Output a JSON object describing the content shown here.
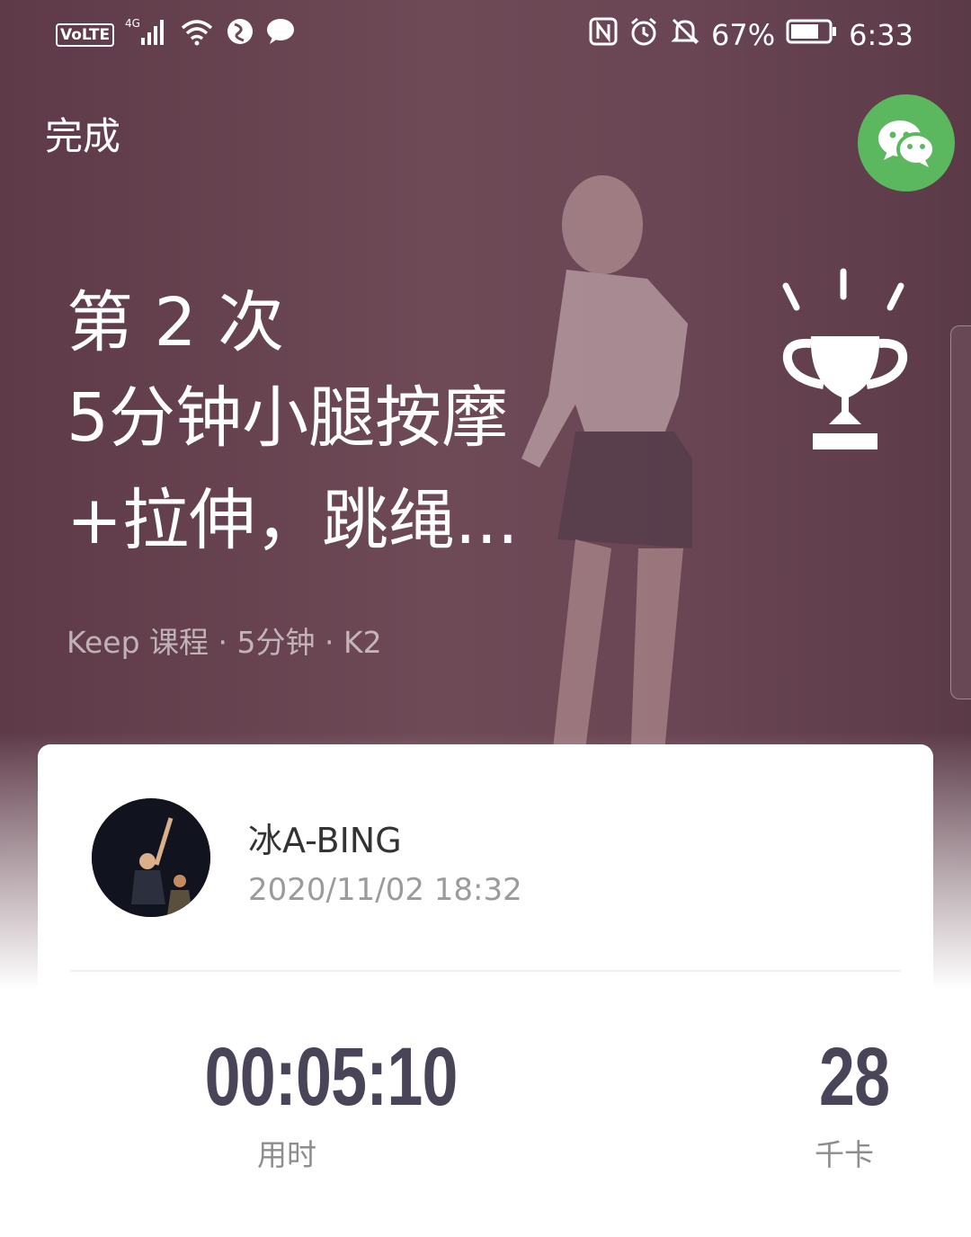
{
  "status_bar": {
    "volte": "VoLTE",
    "network": "4G",
    "battery": "67%",
    "time": "6:33"
  },
  "header": {
    "done_label": "完成"
  },
  "workout": {
    "count_label": "第 2 次",
    "title_line1": "5分钟小腿按摩",
    "title_line2": "+拉伸，跳绳...",
    "meta": "Keep 课程 · 5分钟 · K2"
  },
  "user": {
    "name": "冰A-BING",
    "datetime": "2020/11/02 18:32"
  },
  "stats": {
    "duration_value": "00:05:10",
    "duration_label": "用时",
    "calories_value": "28",
    "calories_label": "千卡"
  },
  "colors": {
    "wechat_green": "#5cb85f",
    "hero_tint": "#6a4553",
    "stat_text": "#4a4458"
  },
  "icons": [
    "volte-icon",
    "signal-icon",
    "wifi-icon",
    "vpn-icon",
    "message-icon",
    "nfc-icon",
    "alarm-icon",
    "mute-icon",
    "battery-icon",
    "wechat-icon",
    "trophy-icon"
  ]
}
